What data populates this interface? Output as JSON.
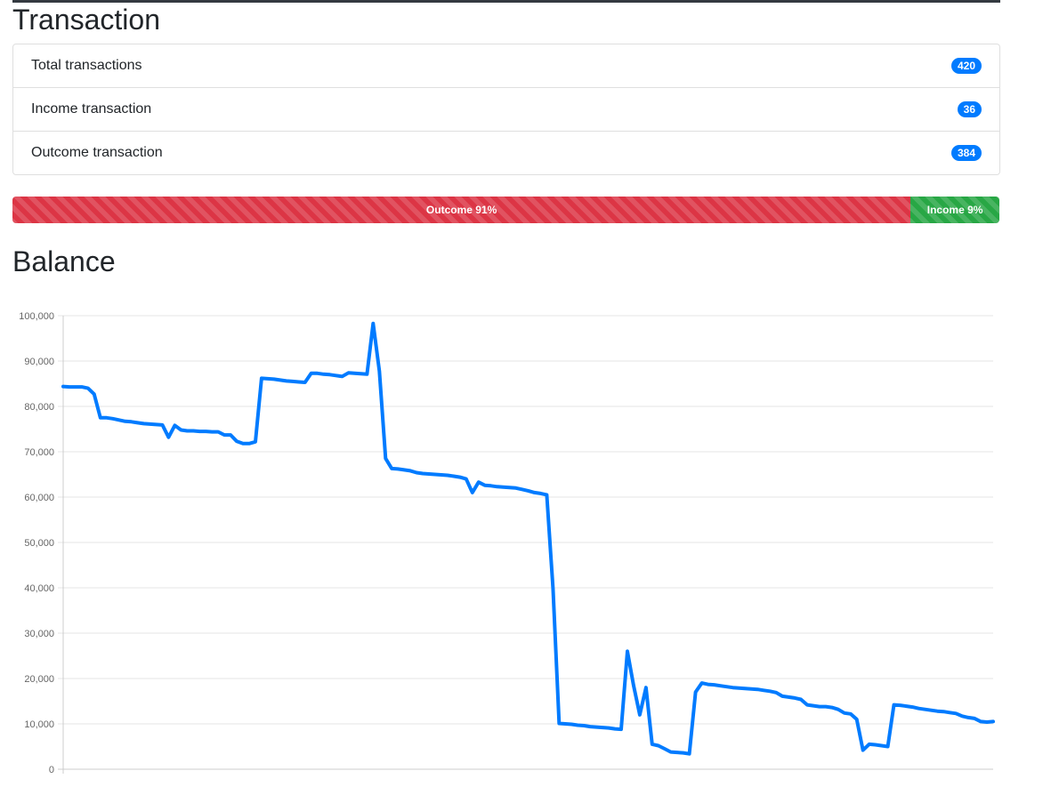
{
  "transaction_section": {
    "title": "Transaction",
    "items": [
      {
        "label": "Total transactions",
        "count": "420"
      },
      {
        "label": "Income transaction",
        "count": "36"
      },
      {
        "label": "Outcome transaction",
        "count": "384"
      }
    ]
  },
  "progress": {
    "outcome_label": "Outcome 91%",
    "outcome_fraction": 0.91,
    "outcome_color": "#dc3545",
    "income_label": "Income 9%",
    "income_fraction": 0.09,
    "income_color": "#28a745"
  },
  "balance_section": {
    "title": "Balance"
  },
  "chart_data": {
    "type": "line",
    "title": "",
    "xlabel": "",
    "ylabel": "",
    "ylim": [
      0,
      100000
    ],
    "y_ticks": [
      "0",
      "10,000",
      "20,000",
      "30,000",
      "40,000",
      "50,000",
      "60,000",
      "70,000",
      "80,000",
      "90,000",
      "100,000"
    ],
    "y_tick_values": [
      0,
      10000,
      20000,
      30000,
      40000,
      50000,
      60000,
      70000,
      80000,
      90000,
      100000
    ],
    "grid": true,
    "line_color": "#007bff",
    "x": [
      0,
      1,
      2,
      3,
      4,
      5,
      6,
      7,
      8,
      9,
      10,
      11,
      12,
      13,
      14,
      15,
      16,
      17,
      18,
      19,
      20,
      21,
      22,
      23,
      24,
      25,
      26,
      27,
      28,
      29,
      30,
      31,
      32,
      33,
      34,
      35,
      36,
      37,
      38,
      39,
      40,
      41,
      42,
      43,
      44,
      45,
      46,
      47,
      48,
      49,
      50,
      51,
      52,
      53,
      54,
      55,
      56,
      57,
      58,
      59,
      60,
      61,
      62,
      63,
      64,
      65,
      66,
      67,
      68,
      69,
      70,
      71,
      72,
      73,
      74,
      75,
      76,
      77,
      78,
      79,
      80,
      81,
      82,
      83,
      84,
      85,
      86,
      87,
      88,
      89,
      90,
      91,
      92,
      93,
      94,
      95,
      96,
      97,
      98,
      99,
      100,
      101,
      102,
      103,
      104,
      105,
      106,
      107,
      108,
      109,
      110,
      111,
      112,
      113,
      114,
      115,
      116,
      117,
      118,
      119,
      120,
      121,
      122,
      123,
      124,
      125,
      126,
      127,
      128,
      129,
      130,
      131,
      132,
      133,
      134,
      135,
      136,
      137,
      138,
      139,
      140,
      141,
      142,
      143,
      144,
      145,
      146,
      147,
      148,
      149,
      150
    ],
    "series": [
      {
        "values": [
          84400,
          84300,
          84300,
          84300,
          84000,
          82700,
          77500,
          77500,
          77300,
          77000,
          76700,
          76600,
          76400,
          76200,
          76100,
          76000,
          75900,
          73200,
          75800,
          74800,
          74600,
          74600,
          74500,
          74500,
          74400,
          74400,
          73700,
          73700,
          72300,
          71800,
          71800,
          72200,
          86200,
          86100,
          86000,
          85800,
          85600,
          85500,
          85400,
          85300,
          87300,
          87300,
          87100,
          87000,
          86800,
          86600,
          87400,
          87300,
          87200,
          87100,
          98300,
          87800,
          68500,
          66300,
          66200,
          66000,
          65800,
          65400,
          65200,
          65100,
          65000,
          64900,
          64800,
          64600,
          64400,
          64000,
          61000,
          63300,
          62600,
          62500,
          62300,
          62200,
          62100,
          62000,
          61700,
          61400,
          61000,
          60800,
          60500,
          39900,
          10100,
          10000,
          9900,
          9700,
          9600,
          9400,
          9300,
          9200,
          9100,
          8900,
          8800,
          26000,
          18500,
          12000,
          18000,
          5500,
          5200,
          4500,
          3800,
          3700,
          3600,
          3400,
          17000,
          19000,
          18700,
          18600,
          18400,
          18200,
          18000,
          17900,
          17800,
          17700,
          17600,
          17400,
          17200,
          16900,
          16100,
          15900,
          15700,
          15400,
          14200,
          14000,
          13800,
          13800,
          13600,
          13200,
          12400,
          12200,
          11000,
          4200,
          5500,
          5400,
          5200,
          5000,
          14200,
          14100,
          13900,
          13700,
          13400,
          13200,
          13000,
          12800,
          12700,
          12500,
          12300,
          11700,
          11400,
          11200,
          10500,
          10400,
          10500
        ]
      }
    ]
  }
}
